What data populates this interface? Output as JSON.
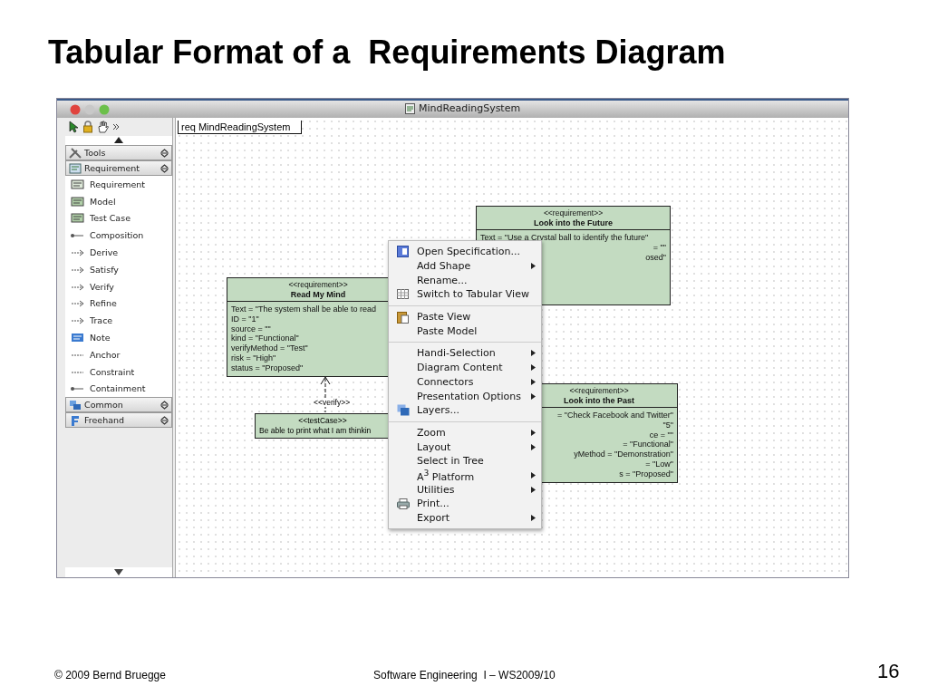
{
  "slide": {
    "title": "Tabular Format of a  Requirements Diagram",
    "footer_left": "© 2009 Bernd Bruegge",
    "footer_center": "Software Engineering  I – WS2009/10",
    "page_number": "16"
  },
  "window": {
    "title": "MindReadingSystem"
  },
  "palette": {
    "groups": [
      {
        "label": "Tools"
      },
      {
        "label": "Requirement",
        "items": [
          "Requirement",
          "Model",
          "Test Case",
          "Composition",
          "Derive",
          "Satisfy",
          "Verify",
          "Refine",
          "Trace",
          "Note",
          "Anchor",
          "Constraint",
          "Containment"
        ]
      },
      {
        "label": "Common"
      },
      {
        "label": "Freehand"
      }
    ]
  },
  "diagram": {
    "frame_label": "req MindReadingSystem",
    "elements": [
      {
        "kind": "requirement",
        "stereotype": "<<requirement>>",
        "name": "Look into the Future",
        "lines": [
          "Text = \"Use a Crystal ball to identify the future\""
        ],
        "fragments": [
          "= \"\"",
          "osed\""
        ]
      },
      {
        "kind": "requirement",
        "stereotype": "<<requirement>>",
        "name": "Read My Mind",
        "lines": [
          "Text = \"The system shall be able to read",
          "ID = \"1\"",
          "source = \"\"",
          "kind = \"Functional\"",
          "verifyMethod = \"Test\"",
          "risk = \"High\"",
          "status = \"Proposed\""
        ]
      },
      {
        "kind": "testcase",
        "stereotype": "<<testCase>>",
        "name": "Be able  to print what I am thinkin"
      },
      {
        "kind": "requirement",
        "stereotype": "<<requirement>>",
        "name": "Look into the Past",
        "fragments": [
          "= \"Check Facebook and Twitter\"",
          "\"5\"",
          "ce = \"\"",
          "= \"Functional\"",
          "yMethod = \"Demonstration\"",
          "= \"Low\"",
          "s = \"Proposed\""
        ]
      }
    ],
    "connector_label": "<<verify>>"
  },
  "context_menu": {
    "groups": [
      [
        {
          "label": "Open Specification...",
          "kind": "spec",
          "submenu": false
        },
        {
          "label": "Add Shape",
          "kind": "plain",
          "submenu": true
        },
        {
          "label": "Rename...",
          "kind": "plain",
          "submenu": false
        },
        {
          "label": "Switch to Tabular View",
          "kind": "table",
          "submenu": false
        }
      ],
      [
        {
          "label": "Paste View",
          "kind": "paste",
          "submenu": false
        },
        {
          "label": "Paste Model",
          "kind": "plain",
          "submenu": false
        }
      ],
      [
        {
          "label": "Handi-Selection",
          "kind": "plain",
          "submenu": true
        },
        {
          "label": "Diagram Content",
          "kind": "plain",
          "submenu": true
        },
        {
          "label": "Connectors",
          "kind": "plain",
          "submenu": true
        },
        {
          "label": "Presentation Options",
          "kind": "plain",
          "submenu": true
        },
        {
          "label": "Layers...",
          "kind": "layers",
          "submenu": false
        }
      ],
      [
        {
          "label": "Zoom",
          "kind": "plain",
          "submenu": true
        },
        {
          "label": "Layout",
          "kind": "plain",
          "submenu": true
        },
        {
          "label": "Select in Tree",
          "kind": "plain",
          "submenu": false
        },
        {
          "label": "A$^{3}$ Platform",
          "kind": "plain",
          "submenu": true
        },
        {
          "label": "Utilities",
          "kind": "plain",
          "submenu": true
        },
        {
          "label": "Print...",
          "kind": "print",
          "submenu": false
        },
        {
          "label": "Export",
          "kind": "plain",
          "submenu": true
        }
      ]
    ]
  }
}
